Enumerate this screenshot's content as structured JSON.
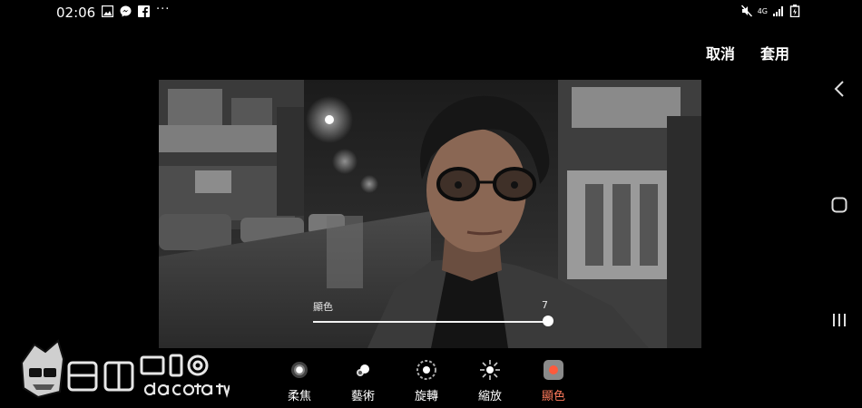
{
  "status_bar": {
    "time": "02:06",
    "left_icons": [
      "image-icon",
      "messenger-icon",
      "facebook-icon"
    ],
    "more": "···",
    "network": "4G",
    "right_icons": [
      "mute-icon",
      "network-4g-icon",
      "signal-icon",
      "battery-icon"
    ]
  },
  "header": {
    "cancel_label": "取消",
    "apply_label": "套用"
  },
  "nav": {
    "icons": [
      "back-icon",
      "home-icon",
      "recents-icon"
    ]
  },
  "slider": {
    "label": "顯色",
    "value": "7",
    "level": 1.0
  },
  "tools": [
    {
      "id": "soft-focus",
      "label": "柔焦",
      "active": false
    },
    {
      "id": "art",
      "label": "藝術",
      "active": false
    },
    {
      "id": "spin",
      "label": "旋轉",
      "active": false
    },
    {
      "id": "zoom",
      "label": "縮放",
      "active": false
    },
    {
      "id": "color-point",
      "label": "顯色",
      "active": true
    }
  ],
  "colors": {
    "accent": "#ff7a5c",
    "background": "#000000"
  }
}
